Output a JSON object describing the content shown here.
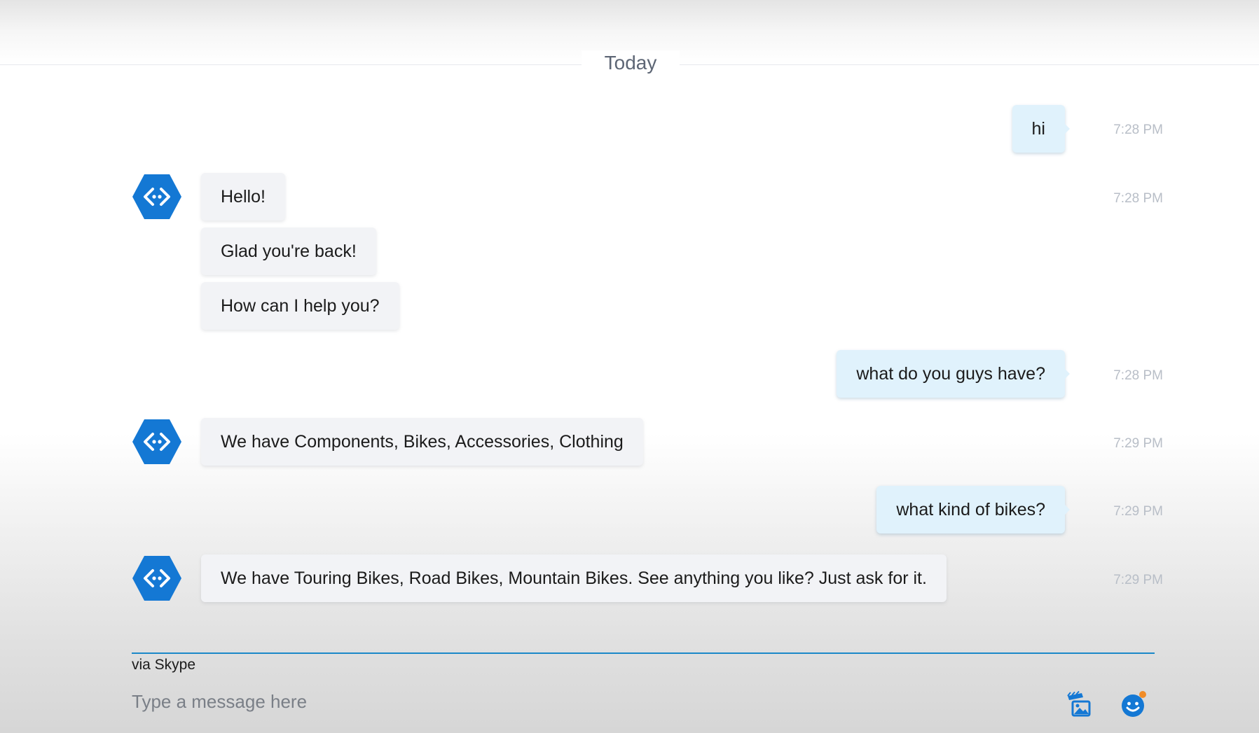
{
  "chat": {
    "date_label": "Today",
    "colors": {
      "user_bubble": "#e0f2fc",
      "bot_bubble": "#f2f3f6",
      "bot_avatar": "#1478d4",
      "input_underline": "#1b88c8",
      "emoji_badge": "#f08c28"
    },
    "messages": [
      {
        "sender": "user",
        "text": "hi",
        "time": "7:28 PM"
      },
      {
        "sender": "bot",
        "text": "Hello!",
        "time": "7:28 PM"
      },
      {
        "sender": "bot",
        "text": "Glad you're back!"
      },
      {
        "sender": "bot",
        "text": "How can I help you?"
      },
      {
        "sender": "user",
        "text": "what do you guys have?",
        "time": "7:28 PM"
      },
      {
        "sender": "bot",
        "text": "We have Components, Bikes, Accessories, Clothing",
        "time": "7:29 PM"
      },
      {
        "sender": "user",
        "text": "what kind of bikes?",
        "time": "7:29 PM"
      },
      {
        "sender": "bot",
        "text": "We have Touring Bikes, Road Bikes, Mountain Bikes. See anything you like? Just ask for it.",
        "time": "7:29 PM"
      }
    ]
  },
  "composer": {
    "via_label": "via Skype",
    "placeholder": "Type a message here",
    "value": "",
    "media_icon": "media-send-icon",
    "emoji_icon": "emoji-icon"
  }
}
